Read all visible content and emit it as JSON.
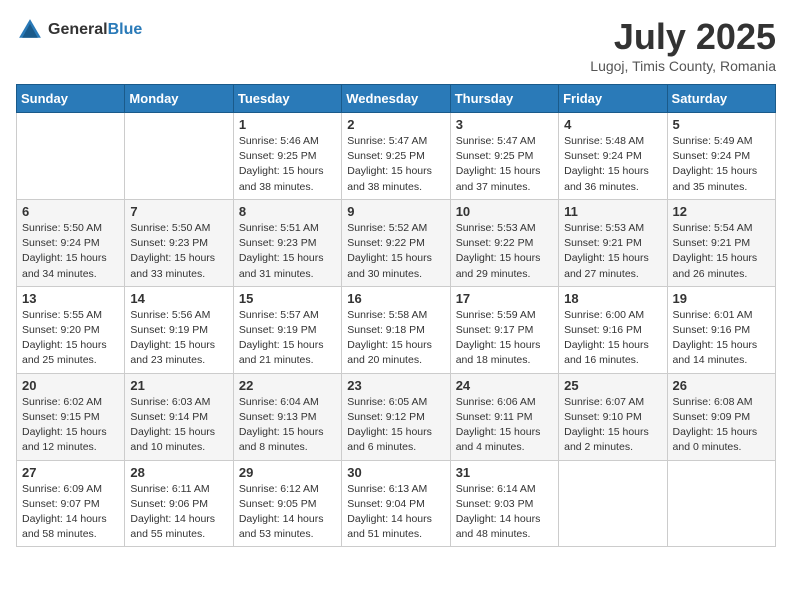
{
  "header": {
    "logo_general": "General",
    "logo_blue": "Blue",
    "month": "July 2025",
    "location": "Lugoj, Timis County, Romania"
  },
  "weekdays": [
    "Sunday",
    "Monday",
    "Tuesday",
    "Wednesday",
    "Thursday",
    "Friday",
    "Saturday"
  ],
  "weeks": [
    [
      {
        "day": "",
        "info": ""
      },
      {
        "day": "",
        "info": ""
      },
      {
        "day": "1",
        "info": "Sunrise: 5:46 AM\nSunset: 9:25 PM\nDaylight: 15 hours and 38 minutes."
      },
      {
        "day": "2",
        "info": "Sunrise: 5:47 AM\nSunset: 9:25 PM\nDaylight: 15 hours and 38 minutes."
      },
      {
        "day": "3",
        "info": "Sunrise: 5:47 AM\nSunset: 9:25 PM\nDaylight: 15 hours and 37 minutes."
      },
      {
        "day": "4",
        "info": "Sunrise: 5:48 AM\nSunset: 9:24 PM\nDaylight: 15 hours and 36 minutes."
      },
      {
        "day": "5",
        "info": "Sunrise: 5:49 AM\nSunset: 9:24 PM\nDaylight: 15 hours and 35 minutes."
      }
    ],
    [
      {
        "day": "6",
        "info": "Sunrise: 5:50 AM\nSunset: 9:24 PM\nDaylight: 15 hours and 34 minutes."
      },
      {
        "day": "7",
        "info": "Sunrise: 5:50 AM\nSunset: 9:23 PM\nDaylight: 15 hours and 33 minutes."
      },
      {
        "day": "8",
        "info": "Sunrise: 5:51 AM\nSunset: 9:23 PM\nDaylight: 15 hours and 31 minutes."
      },
      {
        "day": "9",
        "info": "Sunrise: 5:52 AM\nSunset: 9:22 PM\nDaylight: 15 hours and 30 minutes."
      },
      {
        "day": "10",
        "info": "Sunrise: 5:53 AM\nSunset: 9:22 PM\nDaylight: 15 hours and 29 minutes."
      },
      {
        "day": "11",
        "info": "Sunrise: 5:53 AM\nSunset: 9:21 PM\nDaylight: 15 hours and 27 minutes."
      },
      {
        "day": "12",
        "info": "Sunrise: 5:54 AM\nSunset: 9:21 PM\nDaylight: 15 hours and 26 minutes."
      }
    ],
    [
      {
        "day": "13",
        "info": "Sunrise: 5:55 AM\nSunset: 9:20 PM\nDaylight: 15 hours and 25 minutes."
      },
      {
        "day": "14",
        "info": "Sunrise: 5:56 AM\nSunset: 9:19 PM\nDaylight: 15 hours and 23 minutes."
      },
      {
        "day": "15",
        "info": "Sunrise: 5:57 AM\nSunset: 9:19 PM\nDaylight: 15 hours and 21 minutes."
      },
      {
        "day": "16",
        "info": "Sunrise: 5:58 AM\nSunset: 9:18 PM\nDaylight: 15 hours and 20 minutes."
      },
      {
        "day": "17",
        "info": "Sunrise: 5:59 AM\nSunset: 9:17 PM\nDaylight: 15 hours and 18 minutes."
      },
      {
        "day": "18",
        "info": "Sunrise: 6:00 AM\nSunset: 9:16 PM\nDaylight: 15 hours and 16 minutes."
      },
      {
        "day": "19",
        "info": "Sunrise: 6:01 AM\nSunset: 9:16 PM\nDaylight: 15 hours and 14 minutes."
      }
    ],
    [
      {
        "day": "20",
        "info": "Sunrise: 6:02 AM\nSunset: 9:15 PM\nDaylight: 15 hours and 12 minutes."
      },
      {
        "day": "21",
        "info": "Sunrise: 6:03 AM\nSunset: 9:14 PM\nDaylight: 15 hours and 10 minutes."
      },
      {
        "day": "22",
        "info": "Sunrise: 6:04 AM\nSunset: 9:13 PM\nDaylight: 15 hours and 8 minutes."
      },
      {
        "day": "23",
        "info": "Sunrise: 6:05 AM\nSunset: 9:12 PM\nDaylight: 15 hours and 6 minutes."
      },
      {
        "day": "24",
        "info": "Sunrise: 6:06 AM\nSunset: 9:11 PM\nDaylight: 15 hours and 4 minutes."
      },
      {
        "day": "25",
        "info": "Sunrise: 6:07 AM\nSunset: 9:10 PM\nDaylight: 15 hours and 2 minutes."
      },
      {
        "day": "26",
        "info": "Sunrise: 6:08 AM\nSunset: 9:09 PM\nDaylight: 15 hours and 0 minutes."
      }
    ],
    [
      {
        "day": "27",
        "info": "Sunrise: 6:09 AM\nSunset: 9:07 PM\nDaylight: 14 hours and 58 minutes."
      },
      {
        "day": "28",
        "info": "Sunrise: 6:11 AM\nSunset: 9:06 PM\nDaylight: 14 hours and 55 minutes."
      },
      {
        "day": "29",
        "info": "Sunrise: 6:12 AM\nSunset: 9:05 PM\nDaylight: 14 hours and 53 minutes."
      },
      {
        "day": "30",
        "info": "Sunrise: 6:13 AM\nSunset: 9:04 PM\nDaylight: 14 hours and 51 minutes."
      },
      {
        "day": "31",
        "info": "Sunrise: 6:14 AM\nSunset: 9:03 PM\nDaylight: 14 hours and 48 minutes."
      },
      {
        "day": "",
        "info": ""
      },
      {
        "day": "",
        "info": ""
      }
    ]
  ]
}
